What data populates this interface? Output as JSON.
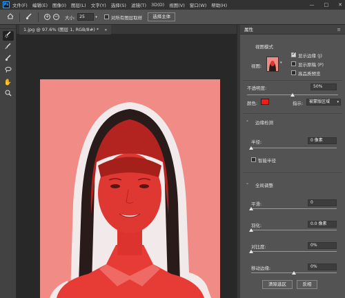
{
  "menubar": {
    "logo": "Ps",
    "items": [
      "文件(F)",
      "编辑(E)",
      "图像(I)",
      "图层(L)",
      "文字(Y)",
      "选择(S)",
      "滤镜(T)",
      "3D(D)",
      "视图(V)",
      "窗口(W)",
      "帮助(H)"
    ],
    "minimize": "—",
    "restore": "□",
    "close": "✕"
  },
  "options": {
    "size_label": "大小:",
    "size_value": "25",
    "sample_all_label": "对所有图层取样",
    "select_subject_label": "选择主体"
  },
  "document": {
    "tab_title": "1.jpg @ 97.6% (图层 1, RGB/8#) *",
    "tab_close": "✕"
  },
  "properties": {
    "panel_title": "属性",
    "view_mode_label": "视图模式",
    "view_label": "视图:",
    "show_edge_label": "显示边缘 (J)",
    "show_original_label": "显示原稿 (P)",
    "hq_preview_label": "高品质预览",
    "opacity_label": "不透明度:",
    "opacity_value": "50%",
    "opacity_level": 0.5,
    "color_label": "颜色:",
    "overlay_color": "#e8211c",
    "indicate_label": "指示:",
    "indicate_value": "被蒙版区域",
    "edge_detection_label": "边缘检测",
    "radius_label": "半径:",
    "radius_value": "0 像素",
    "smart_radius_label": "智能半径",
    "global_refine_label": "全局调整",
    "smooth_label": "平滑:",
    "smooth_value": "0",
    "feather_label": "羽化:",
    "feather_value": "0.0 像素",
    "contrast_label": "对比度:",
    "contrast_value": "0%",
    "shift_edge_label": "移动边缘:",
    "shift_edge_value": "0%",
    "shift_edge_level": 0.5,
    "clear_selection_label": "清除选区",
    "invert_label": "反相"
  },
  "colors": {
    "overlay": "#f08b86",
    "ui_bg": "#535353",
    "accent": "#31a8ff"
  }
}
